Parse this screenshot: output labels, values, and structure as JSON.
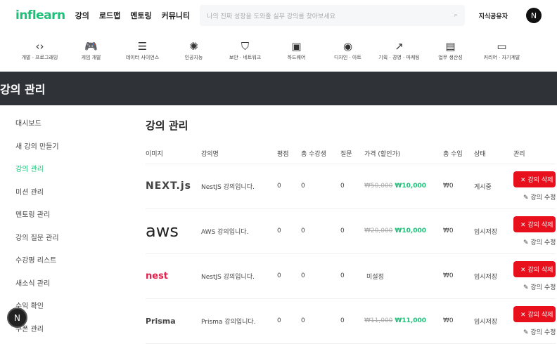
{
  "header": {
    "logo": "inflearn",
    "nav": [
      "강의",
      "로드맵",
      "멘토링",
      "커뮤니티"
    ],
    "search_placeholder": "나의 진짜 성장을 도와줄 실무 강의를 찾아보세요",
    "share": "지식공유자",
    "avatar": "N"
  },
  "categories": [
    {
      "icon": "code-icon",
      "glyph": "‹›",
      "label": "개발 · 프로그래밍"
    },
    {
      "icon": "gamepad-icon",
      "glyph": "🎮",
      "label": "게임 개발"
    },
    {
      "icon": "database-icon",
      "glyph": "☰",
      "label": "데이터 사이언스"
    },
    {
      "icon": "brain-icon",
      "glyph": "✺",
      "label": "인공지능"
    },
    {
      "icon": "shield-icon",
      "glyph": "⛉",
      "label": "보안 · 네트워크"
    },
    {
      "icon": "chip-icon",
      "glyph": "▣",
      "label": "하드웨어"
    },
    {
      "icon": "palette-icon",
      "glyph": "◉",
      "label": "디자인 · 아트"
    },
    {
      "icon": "trend-icon",
      "glyph": "↗",
      "label": "기획 · 경영 · 마케팅"
    },
    {
      "icon": "briefcase-icon",
      "glyph": "▤",
      "label": "업무 생산성"
    },
    {
      "icon": "note-icon",
      "glyph": "▭",
      "label": "커리어 · 자기계발"
    }
  ],
  "band_title": "강의 관리",
  "sidebar": [
    "대시보드",
    "새 강의 만들기",
    "강의 관리",
    "미션 관리",
    "멘토링 관리",
    "강의 질문 관리",
    "수강평 리스트",
    "새소식 관리",
    "수익 확인",
    "쿠폰 관리"
  ],
  "main": {
    "title": "강의 관리",
    "columns": [
      "이미지",
      "강의명",
      "평점",
      "총 수강생",
      "질문",
      "가격 (할인가)",
      "총 수입",
      "상태",
      "관리"
    ],
    "delete_label": "✕  강의 삭제",
    "edit_label": "✎  강의 수정",
    "rows": [
      {
        "logo": "NEXT.js",
        "name": "NestJS 강의입니다.",
        "rating": "0",
        "students": "0",
        "questions": "0",
        "old_price": "₩50,000",
        "price": "₩10,000",
        "revenue": "₩0",
        "status": "게시중"
      },
      {
        "logo": "aws",
        "name": "AWS 강의입니다.",
        "rating": "0",
        "students": "0",
        "questions": "0",
        "old_price": "₩20,000",
        "price": "₩10,000",
        "revenue": "₩0",
        "status": "임시저장"
      },
      {
        "logo": "nest",
        "name": "NestJS 강의입니다.",
        "rating": "0",
        "students": "0",
        "questions": "0",
        "old_price": "",
        "price": "미설정",
        "revenue": "₩0",
        "status": "임시저장"
      },
      {
        "logo": "Prisma",
        "name": "Prisma 강의입니다.",
        "rating": "0",
        "students": "0",
        "questions": "0",
        "old_price": "₩11,000",
        "price": "₩11,000",
        "revenue": "₩0",
        "status": "임시저장"
      }
    ]
  },
  "fab": "N"
}
